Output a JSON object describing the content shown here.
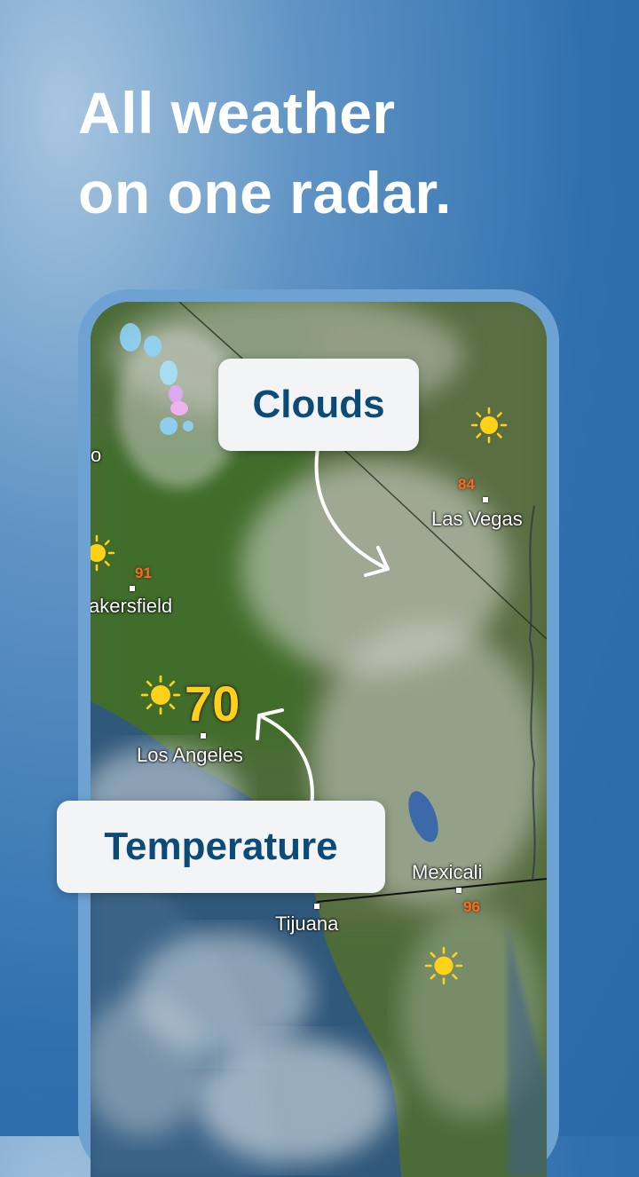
{
  "headline": {
    "line1": "All weather",
    "line2": "on one radar."
  },
  "map": {
    "cities": {
      "las_vegas": "Las Vegas",
      "bakersfield": "akersfield",
      "los_angeles": "Los Angeles",
      "mexicali": "Mexicali",
      "tijuana": "Tijuana",
      "edge_label": "o"
    },
    "temperatures": {
      "las_vegas": "84",
      "bakersfield": "91",
      "los_angeles": "70",
      "mexicali": "96"
    }
  },
  "callouts": {
    "clouds": "Clouds",
    "temperature": "Temperature"
  },
  "colors": {
    "temperature_accent": "#ffcf1d",
    "small_temp": "#ff6a14",
    "callout_text": "#0c4a78"
  }
}
